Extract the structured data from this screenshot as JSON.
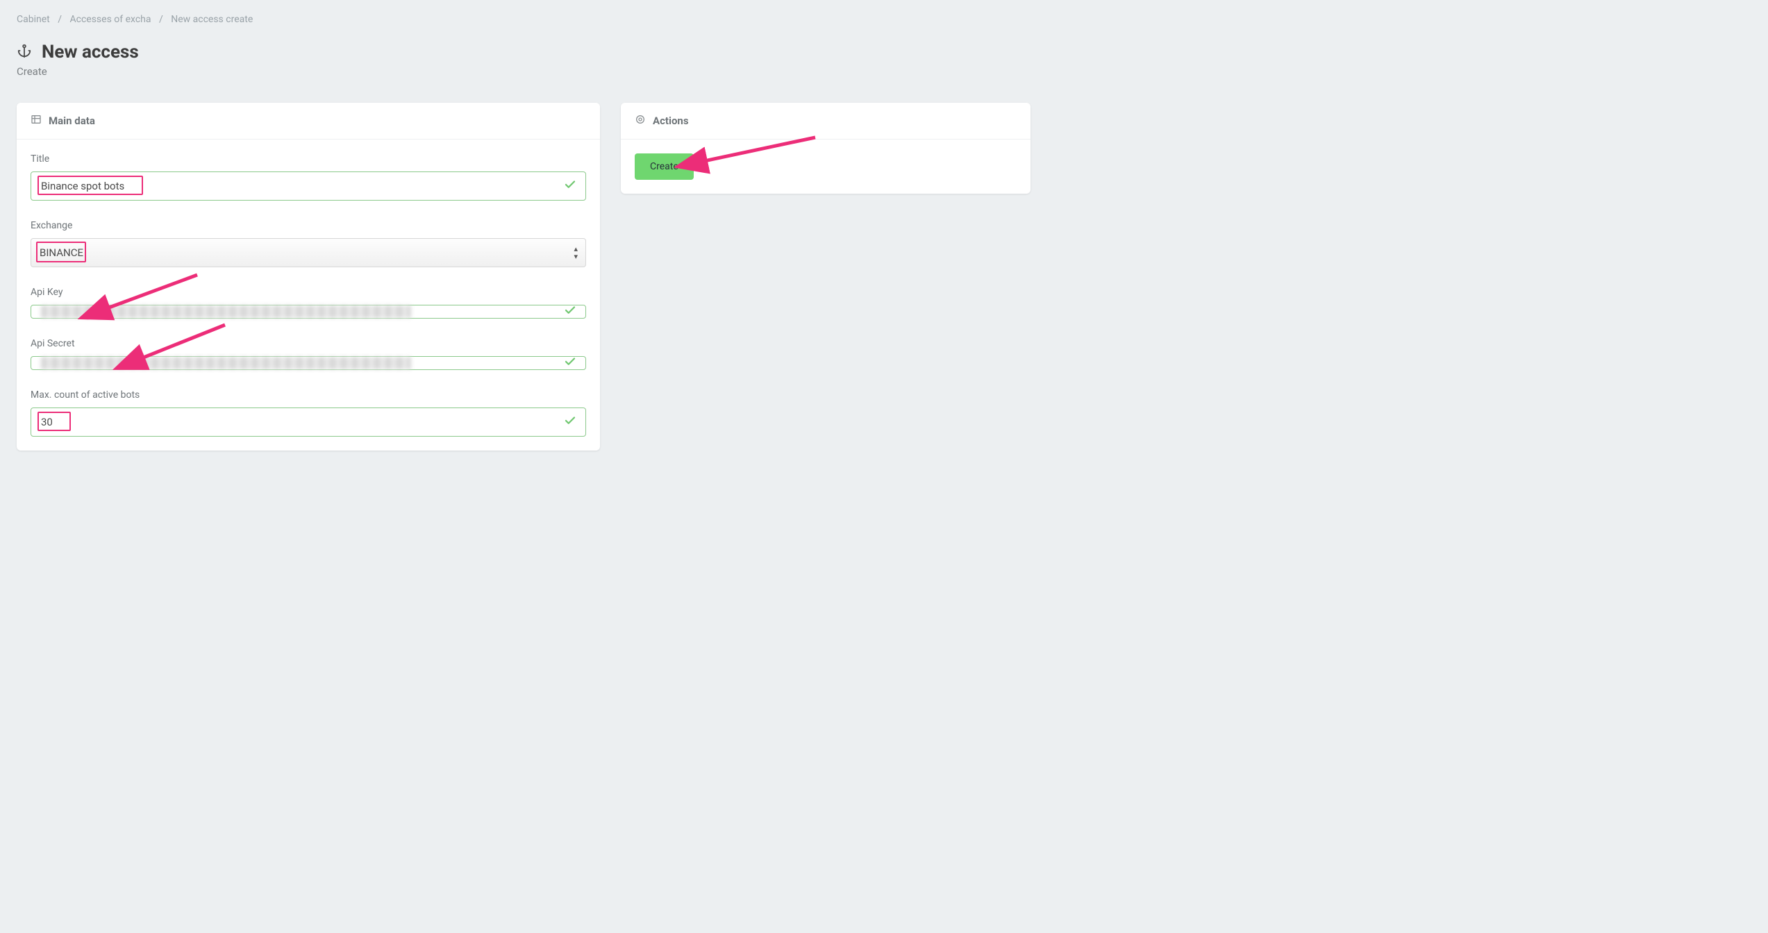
{
  "breadcrumb": {
    "item1": "Cabinet",
    "item2": "Accesses of excha",
    "item3": "New access create"
  },
  "page": {
    "title": "New access",
    "subtitle": "Create"
  },
  "main_card": {
    "header": "Main data",
    "fields": {
      "title": {
        "label": "Title",
        "value": "Binance spot bots"
      },
      "exchange": {
        "label": "Exchange",
        "value": "BINANCE"
      },
      "api_key": {
        "label": "Api Key"
      },
      "api_secret": {
        "label": "Api Secret"
      },
      "max_bots": {
        "label": "Max. count of active bots",
        "value": "30"
      }
    }
  },
  "actions_card": {
    "header": "Actions",
    "create": "Create"
  }
}
